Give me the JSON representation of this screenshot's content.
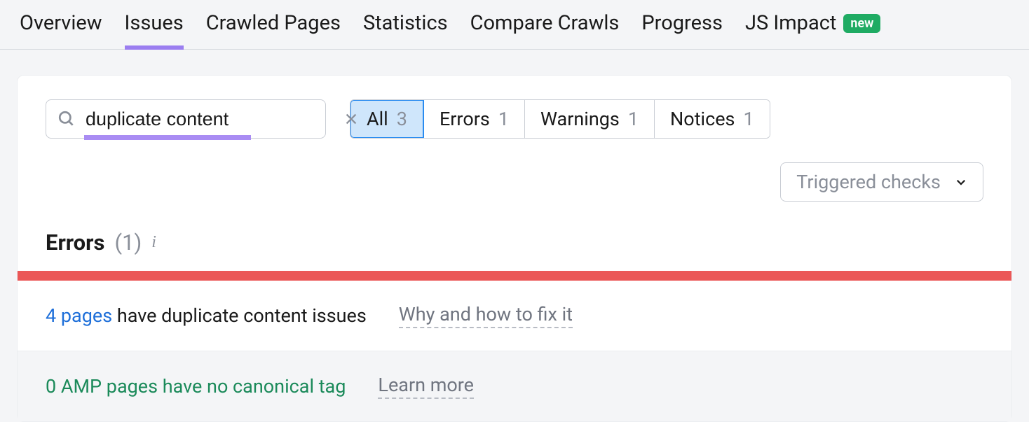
{
  "tabs": [
    {
      "label": "Overview",
      "active": false
    },
    {
      "label": "Issues",
      "active": true
    },
    {
      "label": "Crawled Pages",
      "active": false
    },
    {
      "label": "Statistics",
      "active": false
    },
    {
      "label": "Compare Crawls",
      "active": false
    },
    {
      "label": "Progress",
      "active": false
    },
    {
      "label": "JS Impact",
      "active": false,
      "badge": "new"
    }
  ],
  "search": {
    "value": "duplicate content"
  },
  "filters": [
    {
      "label": "All",
      "count": "3",
      "active": true
    },
    {
      "label": "Errors",
      "count": "1",
      "active": false
    },
    {
      "label": "Warnings",
      "count": "1",
      "active": false
    },
    {
      "label": "Notices",
      "count": "1",
      "active": false
    }
  ],
  "dropdown": {
    "label": "Triggered checks"
  },
  "section": {
    "title": "Errors",
    "count": "(1)"
  },
  "issues": [
    {
      "link_text": "4 pages",
      "rest_text": " have duplicate content issues",
      "fix_text": "Why and how to fix it",
      "muted": false
    },
    {
      "full_text": "0 AMP pages have no canonical tag",
      "fix_text": "Learn more",
      "muted": true
    }
  ]
}
